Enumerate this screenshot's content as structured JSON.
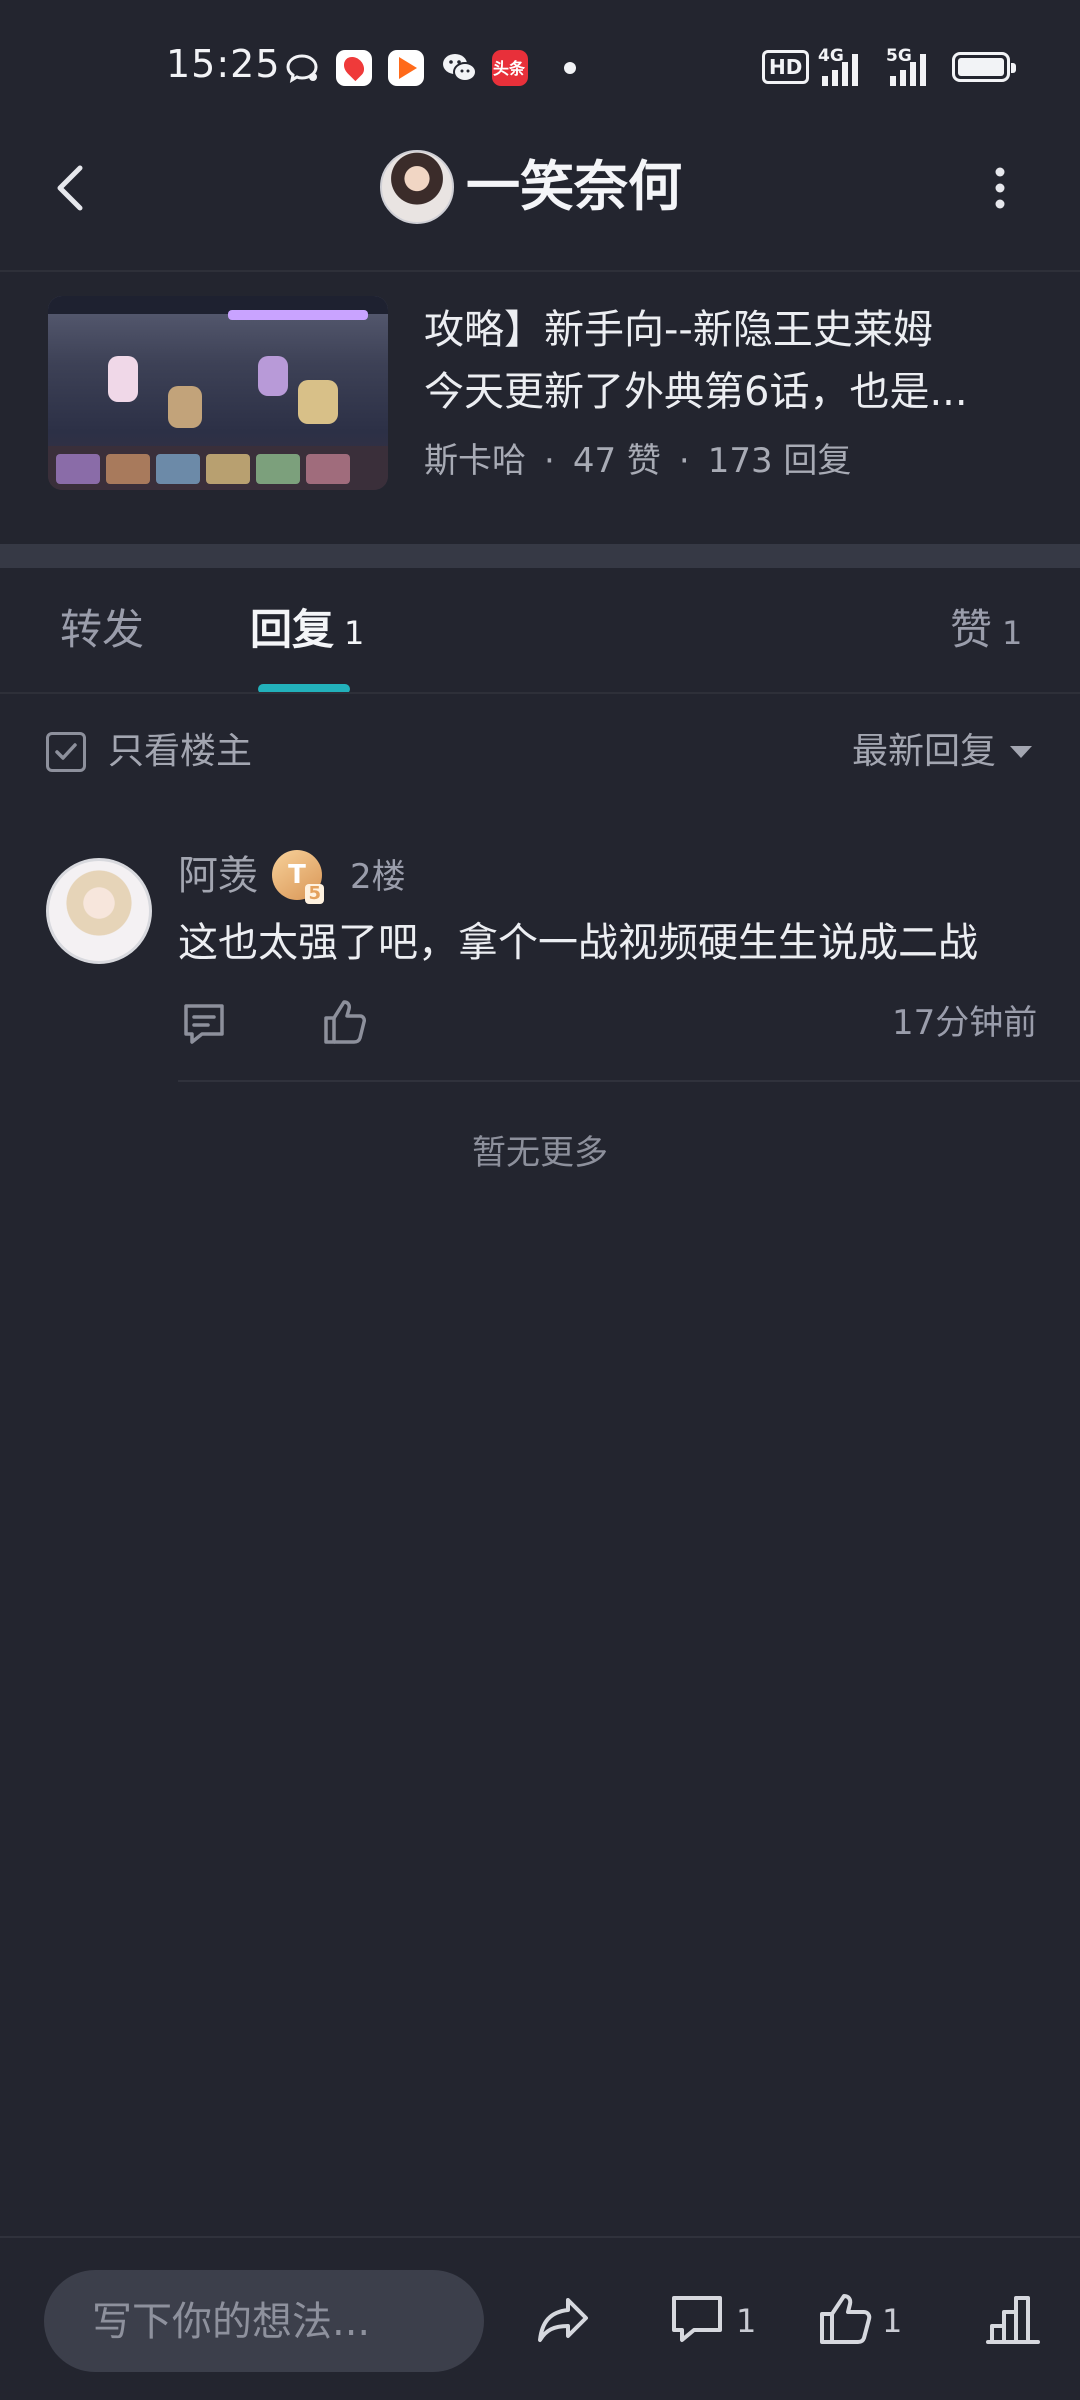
{
  "status_bar": {
    "time": "15:25",
    "notification_icons": [
      "chat-bubble-icon",
      "map-app-icon",
      "video-app-icon",
      "wechat-icon",
      "toutiao-icon",
      "dot-icon"
    ],
    "toutiao_label": "头条",
    "hd_label": "HD",
    "network_1": "4G",
    "network_2": "5G"
  },
  "header": {
    "title": "一笑奈何"
  },
  "post": {
    "title": "攻略】新手向--新隐王史莱姆",
    "snippet": "今天更新了外典第6话，也是...",
    "author": "斯卡哈",
    "likes": "47 赞",
    "replies": "173 回复"
  },
  "tabs": {
    "forward": "转发",
    "reply": "回复",
    "reply_count": "1",
    "like": "赞",
    "like_count": "1",
    "active": "reply",
    "accent_color": "#22b1bb"
  },
  "filter": {
    "only_op_label": "只看楼主",
    "sort_label": "最新回复"
  },
  "reply": {
    "username": "阿羡",
    "level_badge": "T",
    "level_sub": "5",
    "floor": "2楼",
    "content": "这也太强了吧，拿个一战视频硬生生说成二战",
    "time": "17分钟前"
  },
  "no_more_text": "暂无更多",
  "bottom_bar": {
    "input_placeholder": "写下你的想法...",
    "comment_count": "1",
    "like_count": "1"
  }
}
